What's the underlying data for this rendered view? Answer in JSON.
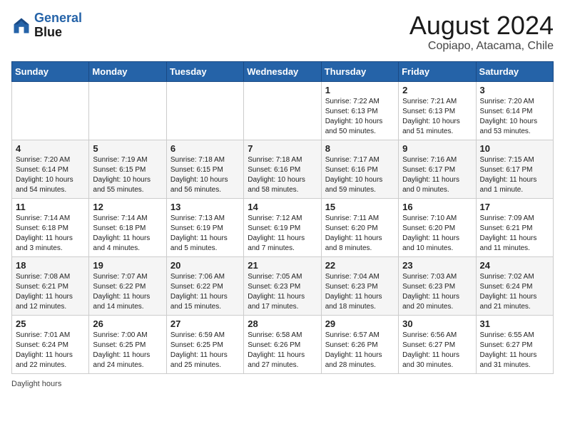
{
  "header": {
    "logo_line1": "General",
    "logo_line2": "Blue",
    "title": "August 2024",
    "subtitle": "Copiapo, Atacama, Chile"
  },
  "weekdays": [
    "Sunday",
    "Monday",
    "Tuesday",
    "Wednesday",
    "Thursday",
    "Friday",
    "Saturday"
  ],
  "weeks": [
    [
      {
        "day": "",
        "info": ""
      },
      {
        "day": "",
        "info": ""
      },
      {
        "day": "",
        "info": ""
      },
      {
        "day": "",
        "info": ""
      },
      {
        "day": "1",
        "info": "Sunrise: 7:22 AM\nSunset: 6:13 PM\nDaylight: 10 hours\nand 50 minutes."
      },
      {
        "day": "2",
        "info": "Sunrise: 7:21 AM\nSunset: 6:13 PM\nDaylight: 10 hours\nand 51 minutes."
      },
      {
        "day": "3",
        "info": "Sunrise: 7:20 AM\nSunset: 6:14 PM\nDaylight: 10 hours\nand 53 minutes."
      }
    ],
    [
      {
        "day": "4",
        "info": "Sunrise: 7:20 AM\nSunset: 6:14 PM\nDaylight: 10 hours\nand 54 minutes."
      },
      {
        "day": "5",
        "info": "Sunrise: 7:19 AM\nSunset: 6:15 PM\nDaylight: 10 hours\nand 55 minutes."
      },
      {
        "day": "6",
        "info": "Sunrise: 7:18 AM\nSunset: 6:15 PM\nDaylight: 10 hours\nand 56 minutes."
      },
      {
        "day": "7",
        "info": "Sunrise: 7:18 AM\nSunset: 6:16 PM\nDaylight: 10 hours\nand 58 minutes."
      },
      {
        "day": "8",
        "info": "Sunrise: 7:17 AM\nSunset: 6:16 PM\nDaylight: 10 hours\nand 59 minutes."
      },
      {
        "day": "9",
        "info": "Sunrise: 7:16 AM\nSunset: 6:17 PM\nDaylight: 11 hours\nand 0 minutes."
      },
      {
        "day": "10",
        "info": "Sunrise: 7:15 AM\nSunset: 6:17 PM\nDaylight: 11 hours\nand 1 minute."
      }
    ],
    [
      {
        "day": "11",
        "info": "Sunrise: 7:14 AM\nSunset: 6:18 PM\nDaylight: 11 hours\nand 3 minutes."
      },
      {
        "day": "12",
        "info": "Sunrise: 7:14 AM\nSunset: 6:18 PM\nDaylight: 11 hours\nand 4 minutes."
      },
      {
        "day": "13",
        "info": "Sunrise: 7:13 AM\nSunset: 6:19 PM\nDaylight: 11 hours\nand 5 minutes."
      },
      {
        "day": "14",
        "info": "Sunrise: 7:12 AM\nSunset: 6:19 PM\nDaylight: 11 hours\nand 7 minutes."
      },
      {
        "day": "15",
        "info": "Sunrise: 7:11 AM\nSunset: 6:20 PM\nDaylight: 11 hours\nand 8 minutes."
      },
      {
        "day": "16",
        "info": "Sunrise: 7:10 AM\nSunset: 6:20 PM\nDaylight: 11 hours\nand 10 minutes."
      },
      {
        "day": "17",
        "info": "Sunrise: 7:09 AM\nSunset: 6:21 PM\nDaylight: 11 hours\nand 11 minutes."
      }
    ],
    [
      {
        "day": "18",
        "info": "Sunrise: 7:08 AM\nSunset: 6:21 PM\nDaylight: 11 hours\nand 12 minutes."
      },
      {
        "day": "19",
        "info": "Sunrise: 7:07 AM\nSunset: 6:22 PM\nDaylight: 11 hours\nand 14 minutes."
      },
      {
        "day": "20",
        "info": "Sunrise: 7:06 AM\nSunset: 6:22 PM\nDaylight: 11 hours\nand 15 minutes."
      },
      {
        "day": "21",
        "info": "Sunrise: 7:05 AM\nSunset: 6:23 PM\nDaylight: 11 hours\nand 17 minutes."
      },
      {
        "day": "22",
        "info": "Sunrise: 7:04 AM\nSunset: 6:23 PM\nDaylight: 11 hours\nand 18 minutes."
      },
      {
        "day": "23",
        "info": "Sunrise: 7:03 AM\nSunset: 6:23 PM\nDaylight: 11 hours\nand 20 minutes."
      },
      {
        "day": "24",
        "info": "Sunrise: 7:02 AM\nSunset: 6:24 PM\nDaylight: 11 hours\nand 21 minutes."
      }
    ],
    [
      {
        "day": "25",
        "info": "Sunrise: 7:01 AM\nSunset: 6:24 PM\nDaylight: 11 hours\nand 22 minutes."
      },
      {
        "day": "26",
        "info": "Sunrise: 7:00 AM\nSunset: 6:25 PM\nDaylight: 11 hours\nand 24 minutes."
      },
      {
        "day": "27",
        "info": "Sunrise: 6:59 AM\nSunset: 6:25 PM\nDaylight: 11 hours\nand 25 minutes."
      },
      {
        "day": "28",
        "info": "Sunrise: 6:58 AM\nSunset: 6:26 PM\nDaylight: 11 hours\nand 27 minutes."
      },
      {
        "day": "29",
        "info": "Sunrise: 6:57 AM\nSunset: 6:26 PM\nDaylight: 11 hours\nand 28 minutes."
      },
      {
        "day": "30",
        "info": "Sunrise: 6:56 AM\nSunset: 6:27 PM\nDaylight: 11 hours\nand 30 minutes."
      },
      {
        "day": "31",
        "info": "Sunrise: 6:55 AM\nSunset: 6:27 PM\nDaylight: 11 hours\nand 31 minutes."
      }
    ]
  ],
  "footer": {
    "label": "Daylight hours"
  }
}
